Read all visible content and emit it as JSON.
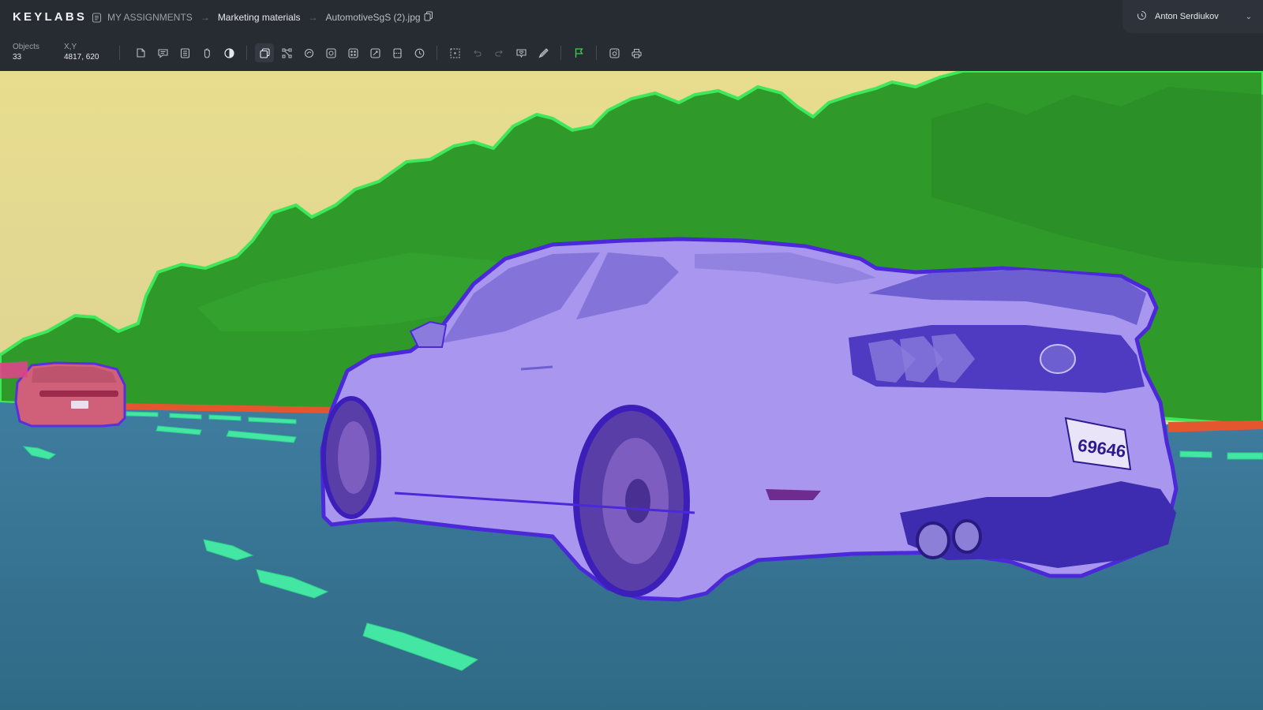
{
  "app": {
    "logo": "KEYLABS"
  },
  "breadcrumb": {
    "home": "MY ASSIGNMENTS",
    "project": "Marketing materials",
    "file": "AutomotiveSgS (2).jpg"
  },
  "user": {
    "name": "Anton Serdiukov"
  },
  "stats": {
    "objects_label": "Objects",
    "objects_value": "33",
    "xy_label": "X,Y",
    "xy_value": "4817, 620"
  },
  "toolbar": {
    "groups": [
      [
        "polygon-icon",
        "comment-icon",
        "list-icon",
        "hand-icon",
        "contrast-icon"
      ],
      [
        "layers-icon",
        "vertex-icon",
        "magic-wand-icon",
        "superpixel-icon",
        "grid-icon",
        "brush-icon",
        "panel-icon",
        "clock-icon"
      ],
      [
        "select-icon",
        "undo-icon",
        "redo-icon",
        "heart-icon",
        "ruler-icon"
      ],
      [
        "flag-icon"
      ],
      [
        "camera-icon",
        "print-icon"
      ]
    ]
  },
  "colors": {
    "accent_flag": "#3ecf4a",
    "sky": "#e2d98f",
    "trees": "#2f9a2a",
    "tree_outline": "#3ee85a",
    "road": "#37728f",
    "car": "#a996ee",
    "car_outline": "#4b28d8",
    "lane": "#44e6a4",
    "barrier": "#e4572e",
    "far_car": "#d0607a"
  }
}
